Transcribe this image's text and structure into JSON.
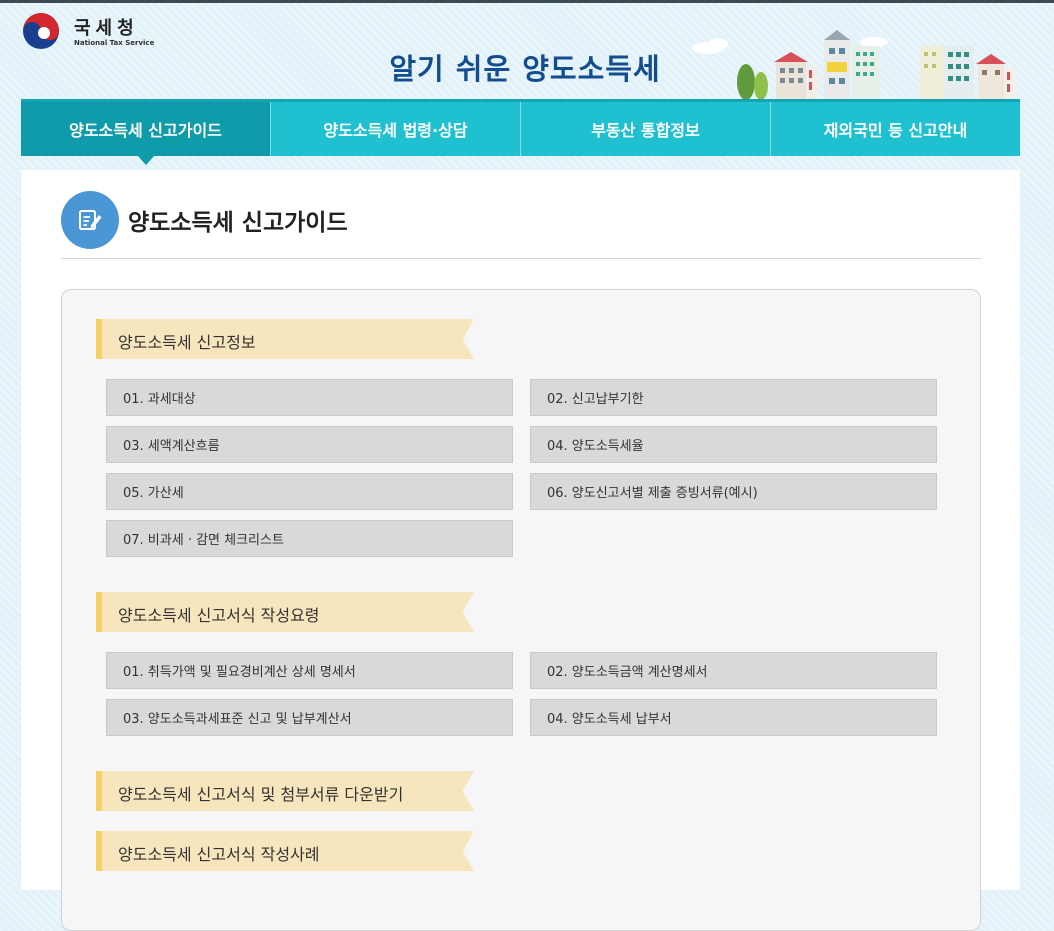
{
  "brand": {
    "logo_ko": "국세청",
    "logo_en": "National Tax Service",
    "site_title": "알기 쉬운 양도소득세"
  },
  "nav": {
    "items": [
      {
        "label": "양도소득세 신고가이드",
        "active": true
      },
      {
        "label": "양도소득세 법령·상담",
        "active": false
      },
      {
        "label": "부동산 통합정보",
        "active": false
      },
      {
        "label": "재외국민 등 신고안내",
        "active": false
      }
    ]
  },
  "page": {
    "title": "양도소득세 신고가이드",
    "icon": "edit-document-icon"
  },
  "sections": [
    {
      "title": "양도소득세 신고정보",
      "items": [
        "01. 과세대상",
        "02. 신고납부기한",
        "03. 세액계산흐름",
        "04. 양도소득세율",
        "05. 가산세",
        "06. 양도신고서별 제출 증빙서류(예시)",
        "07. 비과세 · 감면 체크리스트"
      ]
    },
    {
      "title": "양도소득세 신고서식 작성요령",
      "items": [
        "01. 취득가액 및 필요경비계산 상세 명세서",
        "02. 양도소득금액 계산명세서",
        "03. 양도소득과세표준 신고 및 납부계산서",
        "04. 양도소득세 납부서"
      ]
    },
    {
      "title": "양도소득세 신고서식 및 첨부서류 다운받기",
      "items": []
    },
    {
      "title": "양도소득세 신고서식 작성사례",
      "items": []
    }
  ],
  "colors": {
    "nav_bg": "#1fc0cf",
    "nav_active": "#0f9ba9",
    "title_blue": "#124d8f",
    "banner_bg": "#f7e6bd",
    "banner_edge": "#f6cf67",
    "item_bg": "#d9d9d9",
    "page_icon_bg": "#4b97d6"
  }
}
